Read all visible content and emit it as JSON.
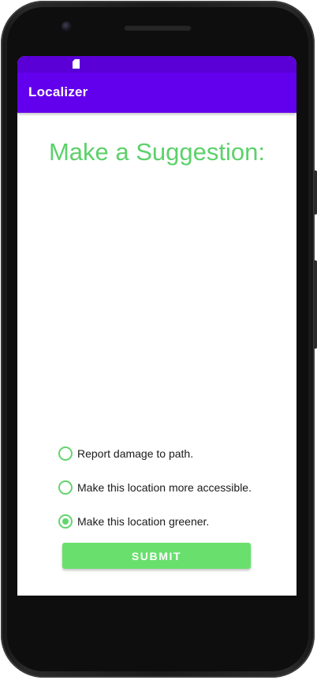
{
  "device": {
    "frame_icon": "phone-frame",
    "camera_icon": "front-camera",
    "speaker_icon": "earpiece-speaker"
  },
  "status_bar": {
    "icons": [
      "sd-card-icon"
    ],
    "color": "#5a00d6"
  },
  "app_bar": {
    "title": "Localizer",
    "color": "#6200ee"
  },
  "main": {
    "heading": "Make a Suggestion:",
    "accent_color": "#5cd16a",
    "options": [
      {
        "label": "Report damage to path.",
        "checked": false
      },
      {
        "label": "Make this location more accessible.",
        "checked": false
      },
      {
        "label": "Make this location greener.",
        "checked": true
      }
    ],
    "submit_label": "SUBMIT",
    "button_color": "#69e06d"
  }
}
